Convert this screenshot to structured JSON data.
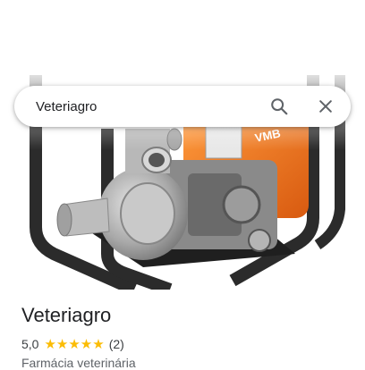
{
  "search": {
    "query": "Veteriagro"
  },
  "icons": {
    "search": "search-icon",
    "close": "close-icon"
  },
  "place": {
    "name": "Veteriagro",
    "rating": "5,0",
    "stars": "★★★★★",
    "review_count": "(2)",
    "category": "Farmácia veterinária"
  },
  "colors": {
    "star": "#fbbc04",
    "engine_orange": "#f0721e",
    "frame": "#2b2b2b"
  }
}
